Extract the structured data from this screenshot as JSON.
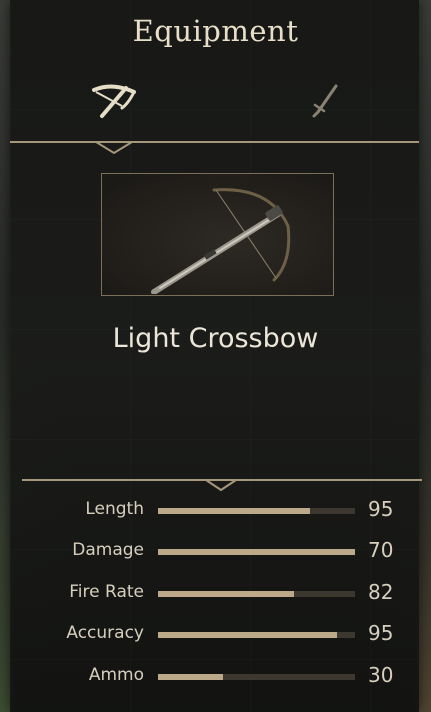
{
  "screen": {
    "title": "Equipment"
  },
  "tabs": [
    {
      "icon": "crossbow-icon",
      "selected": true
    },
    {
      "icon": "sword-icon",
      "selected": false
    }
  ],
  "weapon": {
    "name": "Light Crossbow",
    "image_icon": "crossbow-image"
  },
  "stats": [
    {
      "label": "Length",
      "value": "95",
      "fill": 0.77
    },
    {
      "label": "Damage",
      "value": "70",
      "fill": 1.0
    },
    {
      "label": "Fire Rate",
      "value": "82",
      "fill": 0.69
    },
    {
      "label": "Accuracy",
      "value": "95",
      "fill": 0.91
    },
    {
      "label": "Ammo",
      "value": "30",
      "fill": 0.33
    }
  ],
  "colors": {
    "accent": "#bba98a",
    "track": "#3c3830",
    "text": "#d6cfbd",
    "divider": "#a6977a"
  }
}
